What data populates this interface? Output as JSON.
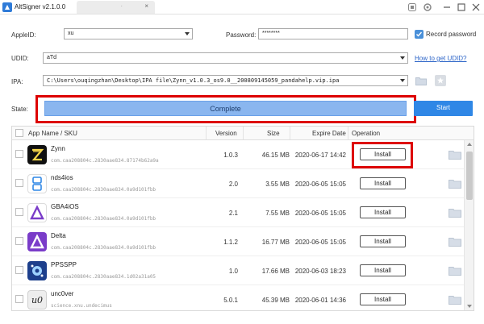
{
  "window": {
    "title": "AltSigner v2.1.0.0",
    "tab_text": "."
  },
  "form": {
    "appleid_label": "AppleID:",
    "appleid_value": "xu",
    "password_label": "Password:",
    "password_value": "********",
    "record_password_label": "Record password",
    "record_password_checked": true,
    "udid_label": "UDID:",
    "udid_value": "aTd",
    "how_to_udid": "How to get UDID?",
    "ipa_label": "IPA:",
    "ipa_value": "C:\\Users\\ouqingzhan\\Desktop\\IPA file\\Zynn_v1.0.3_os9.0__200809145059_pandahelp.vip.ipa"
  },
  "state": {
    "label": "State:",
    "progress_text": "Complete",
    "progress": 1.0,
    "start_label": "Start"
  },
  "table": {
    "headers": {
      "name": "App Name / SKU",
      "version": "Version",
      "size": "Size",
      "expire": "Expire Date",
      "operation": "Operation"
    },
    "rows": [
      {
        "name": "Zynn",
        "sku": "com.caa208804c.2830aae834.87174b62a9a",
        "version": "1.0.3",
        "size": "46.15 MB",
        "expire": "2020-06-17 14:42",
        "action": "Install",
        "icon": "zynn-icon"
      },
      {
        "name": "nds4ios",
        "sku": "com.caa208804c.2830aae834.0a9d101fbb",
        "version": "2.0",
        "size": "3.55 MB",
        "expire": "2020-06-05 15:05",
        "action": "Install",
        "icon": "nds4ios-icon"
      },
      {
        "name": "GBA4iOS",
        "sku": "com.caa208804c.2830aae834.0a9d101fbb",
        "version": "2.1",
        "size": "7.55 MB",
        "expire": "2020-06-05 15:05",
        "action": "Install",
        "icon": "gba4ios-icon"
      },
      {
        "name": "Delta",
        "sku": "com.caa208804c.2830aae834.0a9d101fbb",
        "version": "1.1.2",
        "size": "16.77 MB",
        "expire": "2020-06-05 15:05",
        "action": "Install",
        "icon": "delta-icon"
      },
      {
        "name": "PPSSPP",
        "sku": "com.caa208804c.2830aae834.1d02a31a05",
        "version": "1.0",
        "size": "17.66 MB",
        "expire": "2020-06-03 18:23",
        "action": "Install",
        "icon": "ppsspp-icon"
      },
      {
        "name": "unc0ver",
        "sku": "science.xnu.undecimus",
        "version": "5.0.1",
        "size": "45.39 MB",
        "expire": "2020-06-01 14:36",
        "action": "Install",
        "icon": "unc0ver-icon"
      }
    ]
  },
  "colors": {
    "accent": "#2f87e6",
    "progress": "#8ab6ef",
    "highlight": "#dd0000"
  }
}
